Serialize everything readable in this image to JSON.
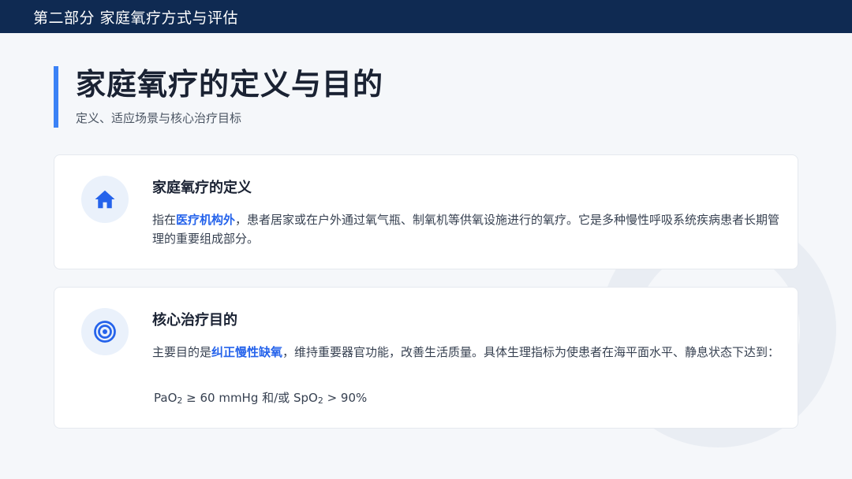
{
  "header": {
    "section_label": "第二部分 家庭氧疗方式与评估"
  },
  "slide": {
    "title": "家庭氧疗的定义与目的",
    "subtitle": "定义、适应场景与核心治疗目标"
  },
  "cards": [
    {
      "icon": "home-icon",
      "title": "家庭氧疗的定义",
      "text_before": "指在",
      "highlight": "医疗机构外",
      "text_after": "，患者居家或在户外通过氧气瓶、制氧机等供氧设施进行的氧疗。它是多种慢性呼吸系统疾病患者长期管理的重要组成部分。"
    },
    {
      "icon": "target-icon",
      "title": "核心治疗目的",
      "text_before": "主要目的是",
      "highlight": "纠正慢性缺氧",
      "text_after": "，维持重要器官功能，改善生活质量。具体生理指标为使患者在海平面水平、静息状态下达到：",
      "formula": {
        "pao_base": "PaO",
        "pao_sub": "2",
        "pao_condition": " ≥ 60 mmHg 和/或 ",
        "spo_base": "SpO",
        "spo_sub": "2",
        "spo_condition": " > 90%"
      }
    }
  ],
  "colors": {
    "header_bg": "#0f2a52",
    "accent": "#3b82f6",
    "highlight": "#2563eb",
    "icon_bg": "#eaf1fb"
  }
}
